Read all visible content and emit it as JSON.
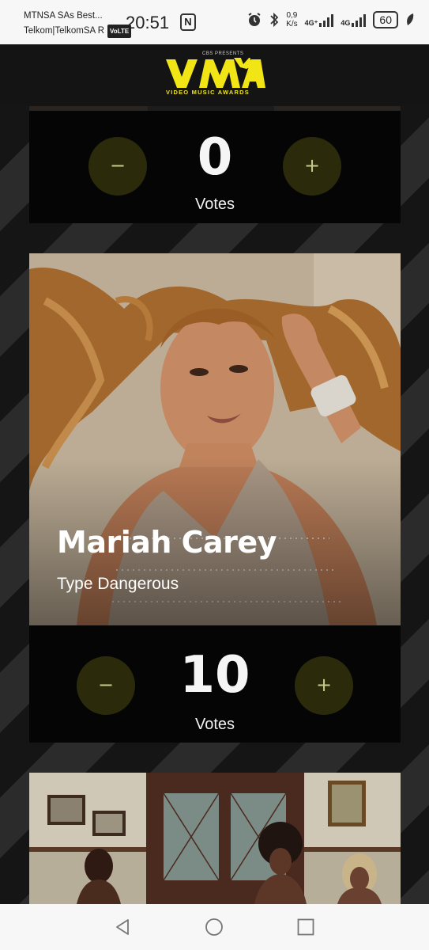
{
  "status_bar": {
    "carrier_line1": "MTNSA SAs Best...",
    "carrier_line2": "Telkom|TelkomSA R",
    "volte": "VoLTE",
    "time": "20:51",
    "nfc": "N",
    "speed_value": "0,9",
    "speed_unit": "K/s",
    "network1": "4G⁺",
    "network2": "4G",
    "battery": "60"
  },
  "header": {
    "presenter": "CBS PRESENTS",
    "logo_text": "VMA",
    "subtitle": "VIDEO MUSIC AWARDS"
  },
  "cards": [
    {
      "votes": "0",
      "votes_label": "Votes",
      "minus": "−",
      "plus": "+"
    },
    {
      "artist": "Mariah Carey",
      "song": "Type Dangerous",
      "votes": "10",
      "votes_label": "Votes",
      "minus": "−",
      "plus": "+"
    }
  ],
  "icons": {
    "alarm": "alarm-icon",
    "bluetooth": "bluetooth-icon",
    "leaf": "leaf-icon",
    "back": "back-icon",
    "home": "home-icon",
    "recents": "recents-icon"
  },
  "colors": {
    "accent_yellow": "#f2e515",
    "vote_button": "#2b2b0c"
  }
}
